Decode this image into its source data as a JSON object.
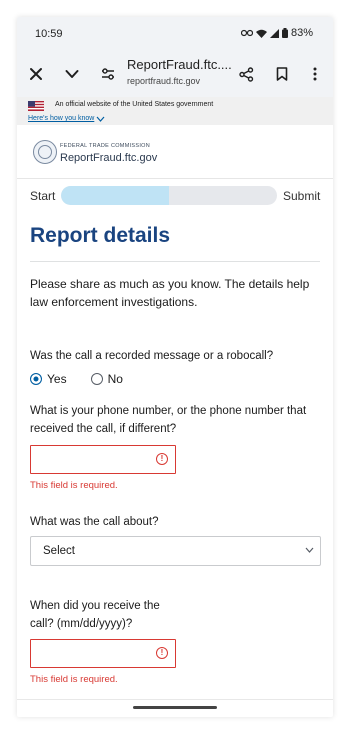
{
  "status_bar": {
    "time": "10:59",
    "battery": "83%"
  },
  "browser": {
    "title": "ReportFraud.ftc....",
    "url": "reportfraud.ftc.gov"
  },
  "gov_banner": {
    "official_text": "An official website of the United States government",
    "how_you_know": "Here's how you know"
  },
  "site_header": {
    "agency": "FEDERAL TRADE COMMISSION",
    "site_name": "ReportFraud.ftc.gov"
  },
  "progress": {
    "start_label": "Start",
    "submit_label": "Submit",
    "value": 0.5
  },
  "page_title": "Report details",
  "intro": "Please share as much as you know. The details help law enforcement investigations.",
  "robocall": {
    "question": "Was the call a recorded message or a robocall?",
    "options": [
      "Yes",
      "No"
    ],
    "selected": "Yes"
  },
  "phone_number": {
    "question": "What is your phone number, or the phone number that received the call, if different?",
    "value": "",
    "error": "This field is required."
  },
  "call_about": {
    "question": "What was the call about?",
    "selected": "Select"
  },
  "call_date": {
    "question": "When did you receive the call? (mm/dd/yyyy)?",
    "value": "",
    "error": "This field is required."
  },
  "colors": {
    "heading": "#1a4480",
    "error": "#d83933",
    "link": "#005ea2",
    "progress_fill": "#bfe3f5"
  }
}
